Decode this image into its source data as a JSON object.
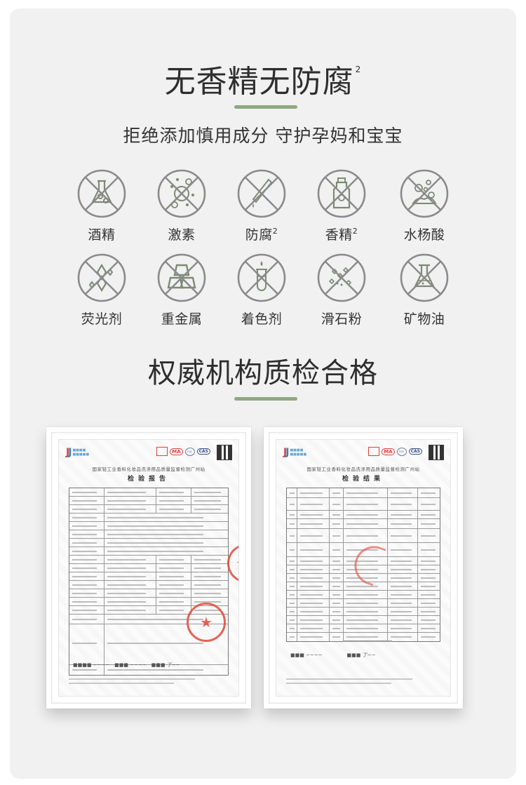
{
  "colors": {
    "accent": "#8fa87f",
    "icon_stroke": "#8a8a8a",
    "icon_fill": "#7d8a74",
    "title_text": "#2e2e2e",
    "stamp_red": "#e24a3a"
  },
  "section1": {
    "title": "无香精无防腐",
    "title_sup": "2",
    "subtitle": "拒绝添加慎用成分 守护孕妈和宝宝"
  },
  "free_from": [
    {
      "icon": "flask-prohibited-icon",
      "label": "酒精",
      "sup": ""
    },
    {
      "icon": "virus-prohibited-icon",
      "label": "激素",
      "sup": ""
    },
    {
      "icon": "dropper-prohibited-icon",
      "label": "防腐",
      "sup": "2"
    },
    {
      "icon": "bottle-prohibited-icon",
      "label": "香精",
      "sup": "2"
    },
    {
      "icon": "bubbles-prohibited-icon",
      "label": "水杨酸",
      "sup": ""
    },
    {
      "icon": "sparkle-prohibited-icon",
      "label": "荧光剂",
      "sup": ""
    },
    {
      "icon": "metal-bars-prohibited-icon",
      "label": "重金属",
      "sup": ""
    },
    {
      "icon": "test-tube-prohibited-icon",
      "label": "着色剂",
      "sup": ""
    },
    {
      "icon": "powder-prohibited-icon",
      "label": "滑石粉",
      "sup": ""
    },
    {
      "icon": "beaker-prohibited-icon",
      "label": "矿物油",
      "sup": ""
    }
  ],
  "section2": {
    "title": "权威机构质检合格"
  },
  "certificates": [
    {
      "org": "国家轻工业香料化妆品洗涤用品质量监督检测广州站",
      "heading": "检验报告",
      "stamp_glyph": "★"
    },
    {
      "org": "国家轻工业香料化妆品洗涤用品质量监督检测广州站",
      "heading": "检验结果",
      "stamp_glyph": "★"
    }
  ]
}
